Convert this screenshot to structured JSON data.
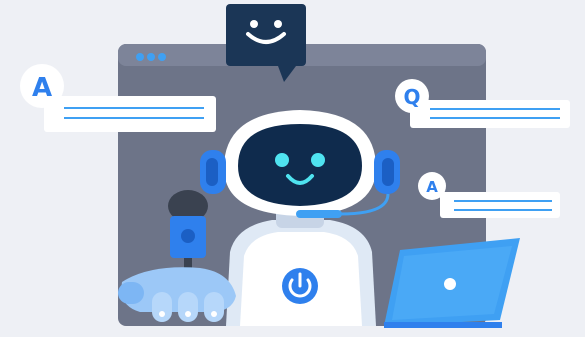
{
  "labels": {
    "answer_left": "A",
    "question_right": "Q",
    "answer_right": "A"
  },
  "colors": {
    "background": "#eef0f5",
    "window": "#6d7488",
    "window_dark": "#525a6e",
    "accent_blue": "#2f80ed",
    "light_blue": "#3fa0f3",
    "face_navy": "#0f2b4d",
    "face_glow": "#4fe3f0",
    "white": "#ffffff"
  },
  "icons": {
    "bubble": "smiley-speech-bubble-icon",
    "power": "power-icon",
    "laptop_logo": "circle-logo-icon",
    "mic": "microphone-icon",
    "headset": "headset-icon"
  }
}
